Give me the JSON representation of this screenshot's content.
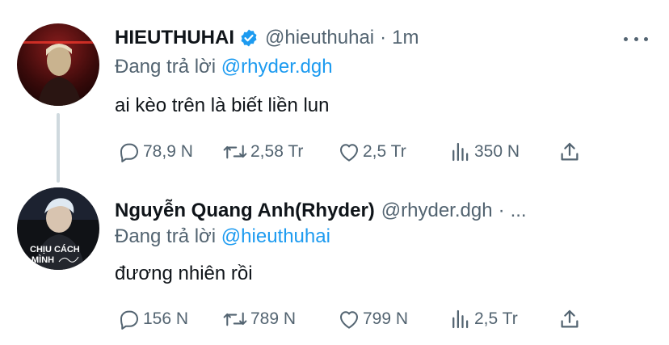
{
  "tweets": [
    {
      "display_name": "HIEUTHUHAI",
      "verified": true,
      "handle": "@hieuthuhai",
      "separator": "·",
      "time": "1m",
      "reply_prefix": "Đang trả lời",
      "reply_to": "@rhyder.dgh",
      "text": "ai kèo trên là biết liền lun",
      "stats": {
        "replies": "78,9 N",
        "retweets": "2,58 Tr",
        "likes": "2,5 Tr",
        "views": "350 N"
      }
    },
    {
      "display_name": "Nguyễn Quang Anh(Rhyder)",
      "verified": false,
      "handle": "@rhyder.dgh",
      "separator": "·",
      "time": "...",
      "reply_prefix": "Đang trả lời",
      "reply_to": "@hieuthuhai",
      "text": "đương nhiên rồi",
      "avatar_text": "CHỊU CÁCH MÌNH",
      "stats": {
        "replies": "156 N",
        "retweets": "789 N",
        "likes": "799 N",
        "views": "2,5 Tr"
      }
    }
  ],
  "colors": {
    "text": "#0f1419",
    "secondary": "#536471",
    "accent": "#1d9bf0",
    "thread_line": "#cfd9de"
  }
}
